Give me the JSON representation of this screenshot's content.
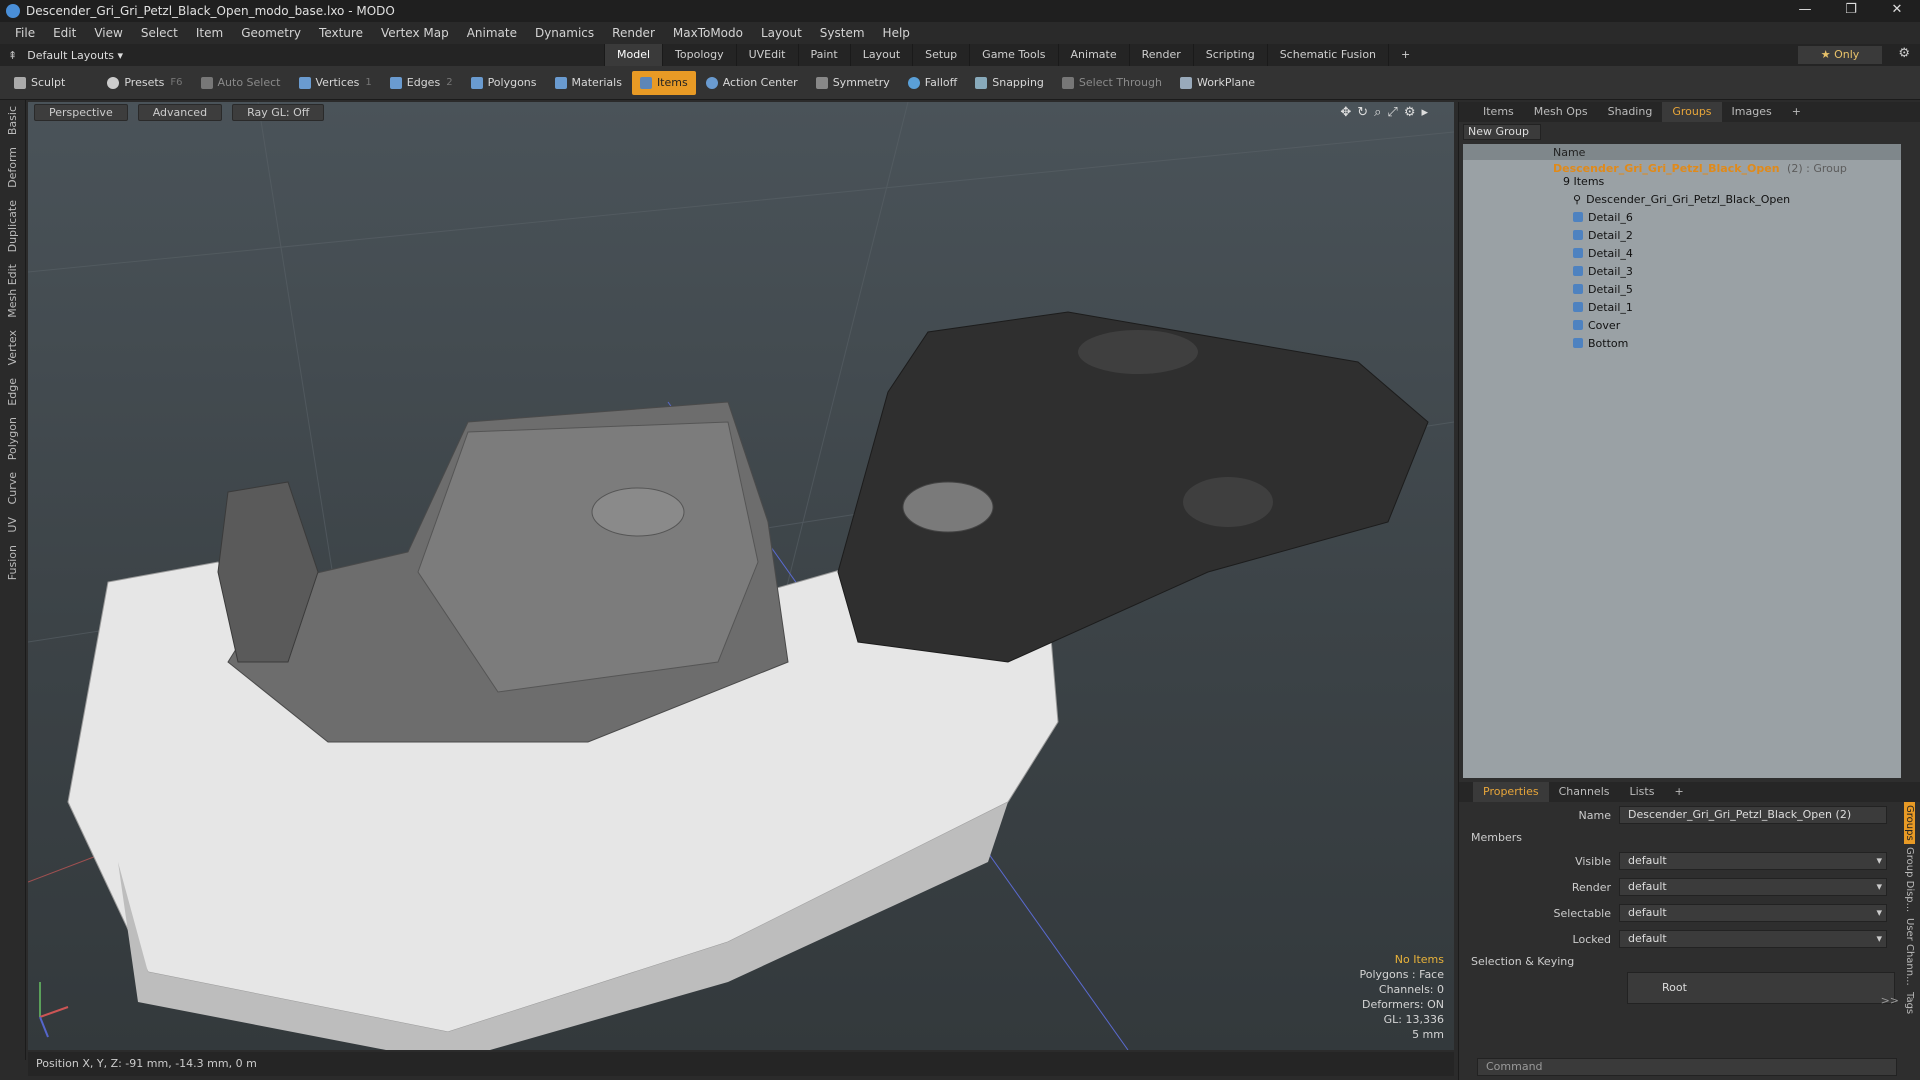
{
  "window": {
    "title": "Descender_Gri_Gri_Petzl_Black_Open_modo_base.lxo - MODO",
    "controls": [
      "—",
      "❐",
      "✕"
    ]
  },
  "menu": [
    "File",
    "Edit",
    "View",
    "Select",
    "Item",
    "Geometry",
    "Texture",
    "Vertex Map",
    "Animate",
    "Dynamics",
    "Render",
    "MaxToModo",
    "Layout",
    "System",
    "Help"
  ],
  "layout_bar": {
    "layouts_label": "Default Layouts ▾",
    "tabs": [
      "Model",
      "Topology",
      "UVEdit",
      "Paint",
      "Layout",
      "Setup",
      "Game Tools",
      "Animate",
      "Render",
      "Scripting",
      "Schematic Fusion",
      "+"
    ],
    "active_tab": "Model",
    "only_label": "★ Only"
  },
  "toolbar": {
    "sculpt": "Sculpt",
    "presets": "Presets",
    "presets_key": "F6",
    "auto_select": "Auto Select",
    "vertices": "Vertices",
    "vertices_key": "1",
    "edges": "Edges",
    "edges_key": "2",
    "polygons": "Polygons",
    "materials": "Materials",
    "items": "Items",
    "action_center": "Action Center",
    "symmetry": "Symmetry",
    "falloff": "Falloff",
    "snapping": "Snapping",
    "select_through": "Select Through",
    "workplane": "WorkPlane"
  },
  "left_tabs": [
    "Basic",
    "Deform",
    "Duplicate",
    "Mesh Edit",
    "Vertex",
    "Edge",
    "Polygon",
    "Curve",
    "UV",
    "Fusion"
  ],
  "viewport": {
    "view_mode": "Perspective",
    "shading": "Advanced",
    "raygl": "Ray GL: Off",
    "info": {
      "selection": "No Items",
      "polygons": "Polygons : Face",
      "channels": "Channels: 0",
      "deformers": "Deformers: ON",
      "gl": "GL: 13,336",
      "scale": "5 mm"
    }
  },
  "status": "Position X, Y, Z:  -91 mm, -14.3 mm, 0 m",
  "groups_panel": {
    "tabs": [
      "Items",
      "Mesh Ops",
      "Shading",
      "Groups",
      "Images",
      "+"
    ],
    "active_tab": "Groups",
    "new_group": "New Group",
    "name_header": "Name",
    "group_name": "Descender_Gri_Gri_Petzl_Black_Open",
    "group_suffix": "(2) : Group",
    "group_count": "9 Items",
    "items": [
      "Descender_Gri_Gri_Petzl_Black_Open",
      "Detail_6",
      "Detail_2",
      "Detail_4",
      "Detail_3",
      "Detail_5",
      "Detail_1",
      "Cover",
      "Bottom"
    ]
  },
  "properties": {
    "tabs": [
      "Properties",
      "Channels",
      "Lists",
      "+"
    ],
    "active_tab": "Properties",
    "name_label": "Name",
    "name_value": "Descender_Gri_Gri_Petzl_Black_Open (2)",
    "members_section": "Members",
    "visible_label": "Visible",
    "visible_value": "default",
    "render_label": "Render",
    "render_value": "default",
    "selectable_label": "Selectable",
    "selectable_value": "default",
    "locked_label": "Locked",
    "locked_value": "default",
    "keying_section": "Selection & Keying",
    "root_label": "Root",
    "more_label": ">>",
    "command_placeholder": "Command",
    "side_tabs": [
      "Groups",
      "Group Disp...",
      "User Chann...",
      "Tags"
    ]
  },
  "colors": {
    "accent": "#e89a25",
    "group_text": "#e08a1a",
    "warn": "#e8b23a"
  }
}
